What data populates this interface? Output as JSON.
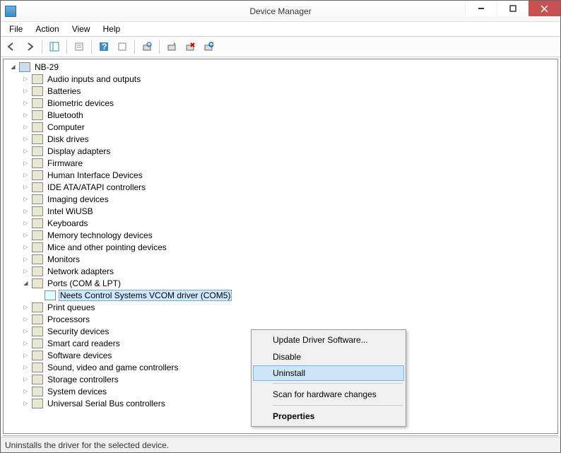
{
  "title": "Device Manager",
  "menubar": [
    "File",
    "Action",
    "View",
    "Help"
  ],
  "root": "NB-29",
  "categories": [
    "Audio inputs and outputs",
    "Batteries",
    "Biometric devices",
    "Bluetooth",
    "Computer",
    "Disk drives",
    "Display adapters",
    "Firmware",
    "Human Interface Devices",
    "IDE ATA/ATAPI controllers",
    "Imaging devices",
    "Intel WiUSB",
    "Keyboards",
    "Memory technology devices",
    "Mice and other pointing devices",
    "Monitors",
    "Network adapters",
    "Ports (COM & LPT)",
    "Print queues",
    "Processors",
    "Security devices",
    "Smart card readers",
    "Software devices",
    "Sound, video and game controllers",
    "Storage controllers",
    "System devices",
    "Universal Serial Bus controllers"
  ],
  "expanded_category_index": 17,
  "expanded_child": "Neets Control Systems VCOM driver (COM5)",
  "context_menu": {
    "items": [
      {
        "label": "Update Driver Software...",
        "sep": false
      },
      {
        "label": "Disable",
        "sep": false
      },
      {
        "label": "Uninstall",
        "sep": true,
        "highlight": true
      },
      {
        "label": "Scan for hardware changes",
        "sep": true
      },
      {
        "label": "Properties",
        "bold": true
      }
    ]
  },
  "status": "Uninstalls the driver for the selected device."
}
